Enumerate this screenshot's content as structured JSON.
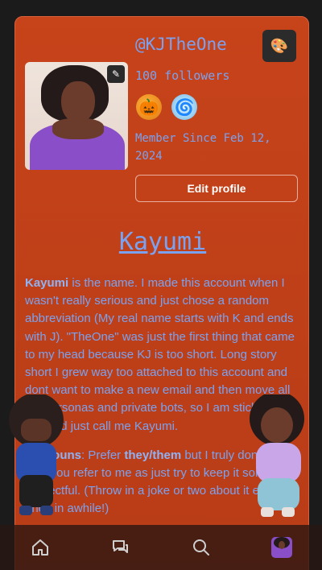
{
  "profile": {
    "username": "@KJTheOne",
    "followers": "100 followers",
    "member_since": "Member Since Feb 12, 2024",
    "edit_profile_label": "Edit profile",
    "badges": [
      "pumpkin-badge",
      "swirl-badge"
    ]
  },
  "bio": {
    "title": "Kayumi",
    "p1_name": "Kayumi",
    "p1_text": " is the name. I made this account when I wasn't really serious and just chose a random abbreviation (My real name starts with K and ends with J). \"TheOne\" was just the first thing that came to my head because KJ is too short. Long story short I grew way too attached to this account and dont want to make a new email and then move all my personas and private bots, so I am sticking to this and just call me Kayumi.",
    "p2_label": "Pronouns",
    "p2_text_a": ": Prefer ",
    "p2_pronouns": "they/them",
    "p2_text_b": " but I truly don't care how you refer to me as just try to keep it somewhat respectful. (Throw in a joke or two about it every once in awhile!)"
  },
  "nav": {
    "items": [
      "home-icon",
      "chat-icon",
      "search-icon",
      "profile-avatar"
    ]
  },
  "colors": {
    "card_bg": "#c7431a",
    "text_accent": "#7aa2f0",
    "page_bg": "#1b1b1b"
  }
}
